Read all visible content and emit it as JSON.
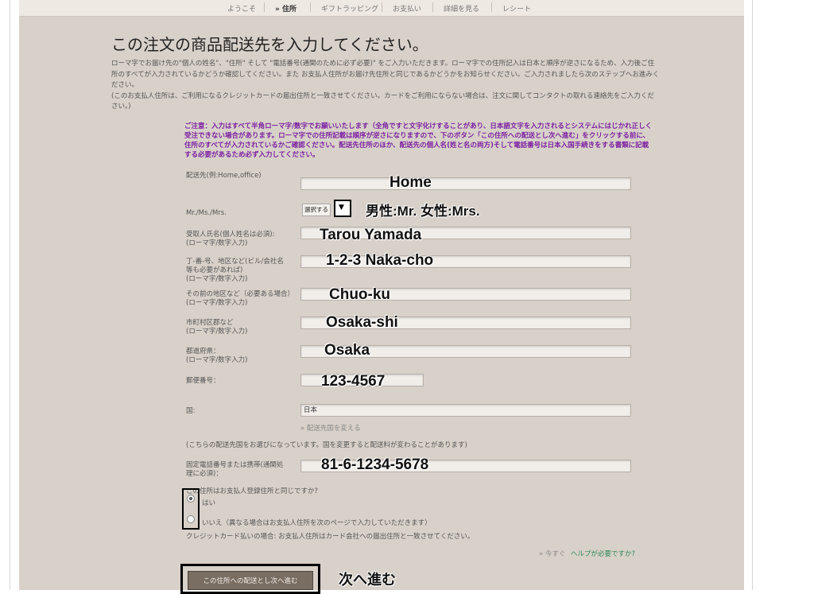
{
  "nav": {
    "items": [
      {
        "label": "ようこそ"
      },
      {
        "label": "» 住所"
      },
      {
        "label": "ギフトラッピング"
      },
      {
        "label": "お支払い"
      },
      {
        "label": "詳細を見る"
      },
      {
        "label": "レシート"
      }
    ]
  },
  "page": {
    "title": "この注文の商品配送先を入力してください。",
    "intro": [
      "ローマ字でお届け先の\"個人の姓名\"、\"住所\" そして \"電話番号(通関のために必ず必要)\" をご入力いただきます。ローマ字での住所記入は日本と順序が逆さになるため、入力後ご住所のすべてが入力されているかどうか確認してください。また お支払人住所がお届け先住所と同じであるかどうかをお知らせください。ご入力されましたら次のステップへお進みください。",
      "(このお支払人住所は、ご利用になるクレジットカードの届出住所と一致させてください。カードをご利用にならない場合は、注文に関してコンタクトの取れる連絡先をご入力ください。)"
    ],
    "notice": "ご注意：入力はすべて半角ローマ字/数字でお願いいたします（全角ですと文字化けすることがあり、日本語文字を入力されるとシステムにはじかれ正しく受注できない場合があります。ローマ字での住所記載は順序が逆さになりますので、下のボタン「この住所への配送とし次へ進む」をクリックする前に、住所のすべてが入力されているかご確認ください。配送先住所のほか、配送先の個人名(姓と名の両方)そして電話番号は日本入国手続きをする書類に記載する必要があるため必ず入力してください。"
  },
  "form": {
    "label_nickname": "配送先(例:Home,office)",
    "value_nickname": "Home",
    "label_title": "Mr./Ms./Mrs.",
    "select_title": "選択する",
    "note_title": "男性:Mr.  女性:Mrs.",
    "label_name": [
      "受取人氏名(個人姓名は必須):",
      "(ローマ字/数字入力)"
    ],
    "value_name": "Tarou Yamada",
    "label_address1": [
      "丁-番-号、地区など(ビル/会社名",
      "等も必要があれば)",
      "(ローマ字/数字入力)"
    ],
    "value_address1": "1-2-3 Naka-cho",
    "label_address2": [
      "その前の地区など（必要ある場合）",
      "(ローマ字/数字入力)"
    ],
    "value_address2": "Chuo-ku",
    "label_city": [
      "市町村区郡など",
      "(ローマ字/数字入力)"
    ],
    "value_city": "Osaka-shi",
    "label_prefecture": [
      "都道府県：",
      "(ローマ字/数字入力)"
    ],
    "value_prefecture": "Osaka",
    "label_postal": "郵便番号：",
    "value_postal": "123-4567",
    "label_country": "国:",
    "value_country": "日本",
    "change_country_link": "» 配送先国を変える",
    "country_note": "(こちらの配送先国をお選びになっています。国を変更すると配送料が変わることがあります)",
    "label_phone": [
      "固定電話番号または携帯(通関処",
      "理に必須)："
    ],
    "value_phone": "81-6-1234-5678",
    "same_address_question": "この住所はお支払人登録住所と同じですか?",
    "option_yes": "はい",
    "option_no": "いいえ（異なる場合はお支払人住所を次のページで入力していただきます）",
    "credit_note": "クレジットカード払いの場合: お支払人住所はカード会社への届出住所と一致させてください。",
    "help_prefix": "» 今すぐ",
    "help_link": "ヘルプが必要ですか?",
    "submit_label": "この住所への配送とし次へ進む",
    "submit_annotation": "次へ進む"
  }
}
